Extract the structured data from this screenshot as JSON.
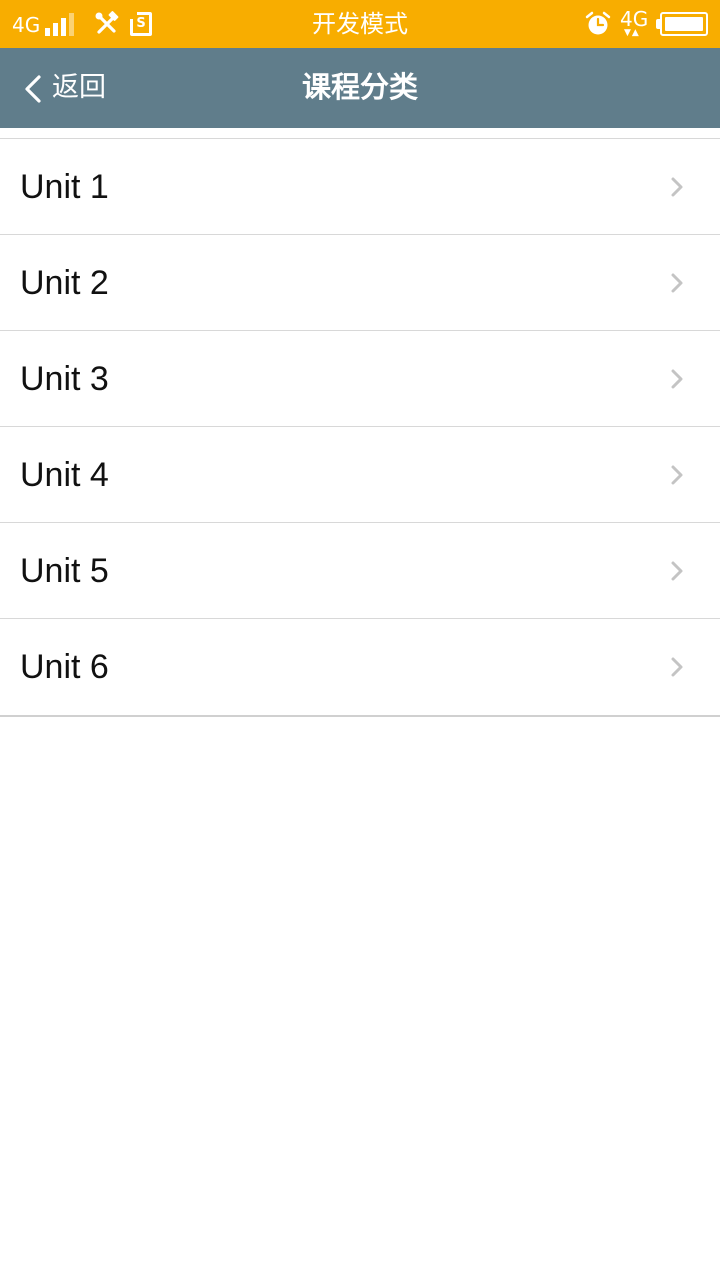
{
  "status_bar": {
    "network_left": "4G",
    "title": "开发模式",
    "network_right": "4G",
    "network_arrows": "▼▲",
    "sim_letter": "S",
    "icons": [
      "signal-icon",
      "tools-icon",
      "sim-icon",
      "alarm-icon",
      "battery-icon"
    ],
    "background_color": "#f8ad00"
  },
  "nav_bar": {
    "back_label": "返回",
    "title": "课程分类",
    "background_color": "#607d8b"
  },
  "units": [
    {
      "label": "Unit 1"
    },
    {
      "label": "Unit 2"
    },
    {
      "label": "Unit 3"
    },
    {
      "label": "Unit 4"
    },
    {
      "label": "Unit 5"
    },
    {
      "label": "Unit 6"
    }
  ]
}
